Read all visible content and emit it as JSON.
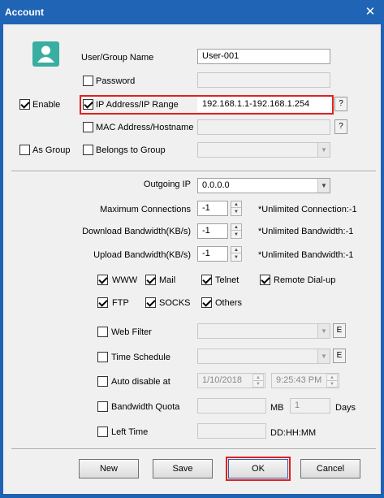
{
  "window": {
    "title": "Account",
    "close_glyph": "✕"
  },
  "identity": {
    "avatar_icon": "user-icon",
    "name_label": "User/Group Name",
    "name_value": "User-001",
    "password_label": "Password",
    "password_checked": false,
    "ip_label": "IP Address/IP Range",
    "ip_checked": true,
    "ip_value": "192.168.1.1-192.168.1.254",
    "mac_label": "MAC Address/Hostname",
    "mac_checked": false,
    "belongs_label": "Belongs to Group",
    "belongs_checked": false,
    "help_glyph": "?"
  },
  "left_options": {
    "enable_label": "Enable",
    "enable_checked": true,
    "as_group_label": "As Group",
    "as_group_checked": false
  },
  "limits": {
    "outgoing_ip_label": "Outgoing IP",
    "outgoing_ip_value": "0.0.0.0",
    "max_conn_label": "Maximum Connections",
    "max_conn_value": "-1",
    "max_conn_note": "*Unlimited Connection:-1",
    "download_label": "Download Bandwidth(KB/s)",
    "download_value": "-1",
    "download_note": "*Unlimited Bandwidth:-1",
    "upload_label": "Upload Bandwidth(KB/s)",
    "upload_value": "-1",
    "upload_note": "*Unlimited Bandwidth:-1"
  },
  "protocols": [
    {
      "label": "WWW",
      "checked": true
    },
    {
      "label": "Mail",
      "checked": true
    },
    {
      "label": "Telnet",
      "checked": true
    },
    {
      "label": "Remote Dial-up",
      "checked": true
    },
    {
      "label": "FTP",
      "checked": true
    },
    {
      "label": "SOCKS",
      "checked": true
    },
    {
      "label": "Others",
      "checked": true
    }
  ],
  "advanced": {
    "web_filter_label": "Web Filter",
    "time_schedule_label": "Time Schedule",
    "edit_glyph": "E",
    "auto_disable_label": "Auto disable at",
    "auto_disable_date": "1/10/2018",
    "auto_disable_time": "9:25:43 PM",
    "quota_label": "Bandwidth Quota",
    "quota_unit": "MB",
    "quota_days_value": "1",
    "quota_days_label": "Days",
    "left_time_label": "Left Time",
    "left_time_format": "DD:HH:MM"
  },
  "buttons": {
    "new": "New",
    "save": "Save",
    "ok": "OK",
    "cancel": "Cancel"
  },
  "colors": {
    "titlebar": "#1f64b5",
    "highlight": "#e02020",
    "avatar": "#3aaea0"
  }
}
